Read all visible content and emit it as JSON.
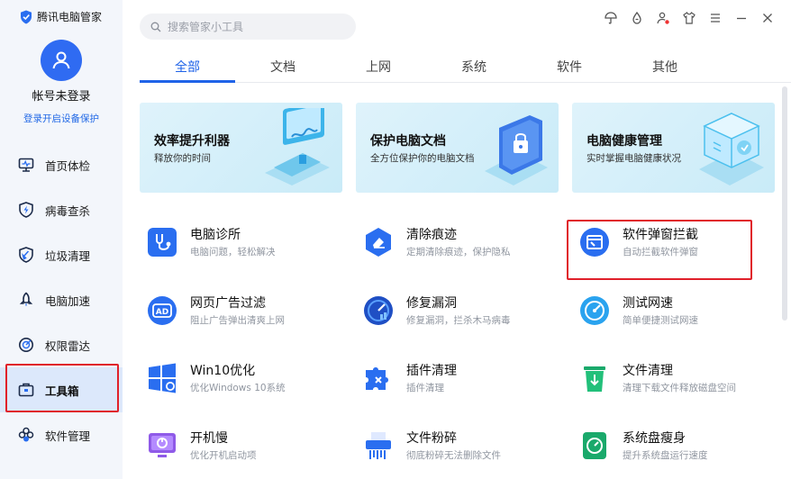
{
  "app": {
    "title": "腾讯电脑管家"
  },
  "account": {
    "name": "帐号未登录",
    "login_link": "登录开启设备保护"
  },
  "sidebar": {
    "items": [
      {
        "label": "首页体检",
        "icon": "monitor-icon"
      },
      {
        "label": "病毒查杀",
        "icon": "lightning-shield-icon"
      },
      {
        "label": "垃圾清理",
        "icon": "broom-icon"
      },
      {
        "label": "电脑加速",
        "icon": "rocket-icon"
      },
      {
        "label": "权限雷达",
        "icon": "radar-icon"
      },
      {
        "label": "工具箱",
        "icon": "toolbox-icon",
        "active": true
      },
      {
        "label": "软件管理",
        "icon": "apps-icon"
      }
    ]
  },
  "search": {
    "placeholder": "搜索管家小工具"
  },
  "tabs": [
    {
      "label": "全部",
      "active": true
    },
    {
      "label": "文档"
    },
    {
      "label": "上网"
    },
    {
      "label": "系统"
    },
    {
      "label": "软件"
    },
    {
      "label": "其他"
    }
  ],
  "banners": [
    {
      "title": "效率提升利器",
      "subtitle": "释放你的时间"
    },
    {
      "title": "保护电脑文档",
      "subtitle": "全方位保护你的电脑文档"
    },
    {
      "title": "电脑健康管理",
      "subtitle": "实时掌握电脑健康状况"
    }
  ],
  "tools": [
    {
      "name": "电脑诊所",
      "desc": "电脑问题，轻松解决"
    },
    {
      "name": "清除痕迹",
      "desc": "定期清除痕迹，保护隐私"
    },
    {
      "name": "软件弹窗拦截",
      "desc": "自动拦截软件弹窗"
    },
    {
      "name": "网页广告过滤",
      "desc": "阻止广告弹出清爽上网"
    },
    {
      "name": "修复漏洞",
      "desc": "修复漏洞，拦杀木马病毒"
    },
    {
      "name": "测试网速",
      "desc": "简单便捷测试网速"
    },
    {
      "name": "Win10优化",
      "desc": "优化Windows 10系统"
    },
    {
      "name": "插件清理",
      "desc": "插件清理"
    },
    {
      "name": "文件清理",
      "desc": "清理下载文件释放磁盘空间"
    },
    {
      "name": "开机慢",
      "desc": "优化开机启动项"
    },
    {
      "name": "文件粉碎",
      "desc": "彻底粉碎无法删除文件"
    },
    {
      "name": "系统盘瘦身",
      "desc": "提升系统盘运行速度"
    }
  ],
  "icons": {
    "ad_badge": "AD"
  },
  "colors": {
    "accent": "#1f63e8",
    "highlight_box": "#e0202a",
    "sidebar_bg": "#f3f6fb"
  }
}
